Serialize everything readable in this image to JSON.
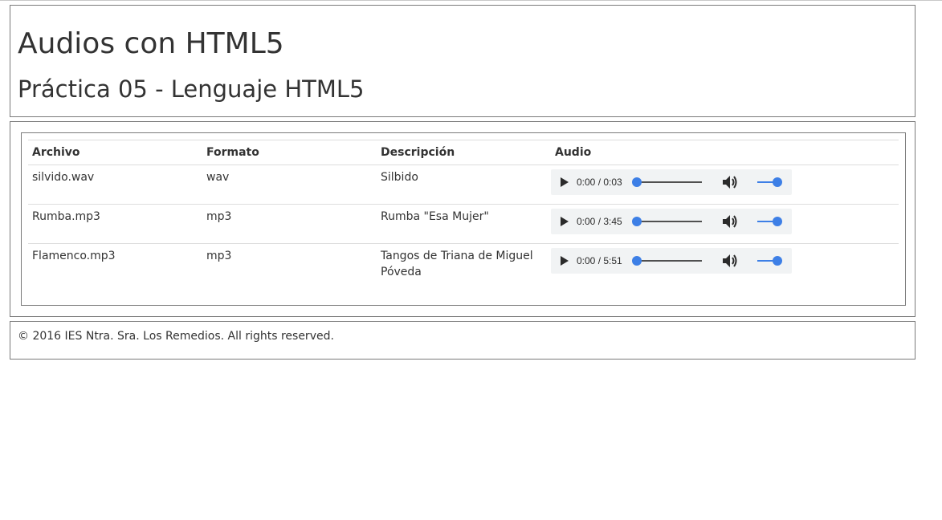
{
  "header": {
    "title": "Audios con HTML5",
    "subtitle": "Práctica 05 - Lenguaje HTML5"
  },
  "table": {
    "columns": [
      "Archivo",
      "Formato",
      "Descripción",
      "Audio"
    ],
    "rows": [
      {
        "archivo": "silvido.wav",
        "formato": "wav",
        "descripcion": "Silbido",
        "time": "0:00 / 0:03",
        "progress": 0,
        "volume": 1
      },
      {
        "archivo": "Rumba.mp3",
        "formato": "mp3",
        "descripcion": "Rumba \"Esa Mujer\"",
        "time": "0:00 / 3:45",
        "progress": 0,
        "volume": 1
      },
      {
        "archivo": "Flamenco.mp3",
        "formato": "mp3",
        "descripcion": "Tangos de Triana de Miguel Póveda",
        "time": "0:00 / 5:51",
        "progress": 0,
        "volume": 1
      }
    ]
  },
  "icons": {
    "play": "play-icon",
    "volume": "volume-icon"
  },
  "colors": {
    "accent": "#3d7fe6",
    "player_bg": "#f1f3f4",
    "border": "#7a7a7a"
  },
  "footer": {
    "text": "© 2016 IES Ntra. Sra. Los Remedios. All rights reserved."
  }
}
